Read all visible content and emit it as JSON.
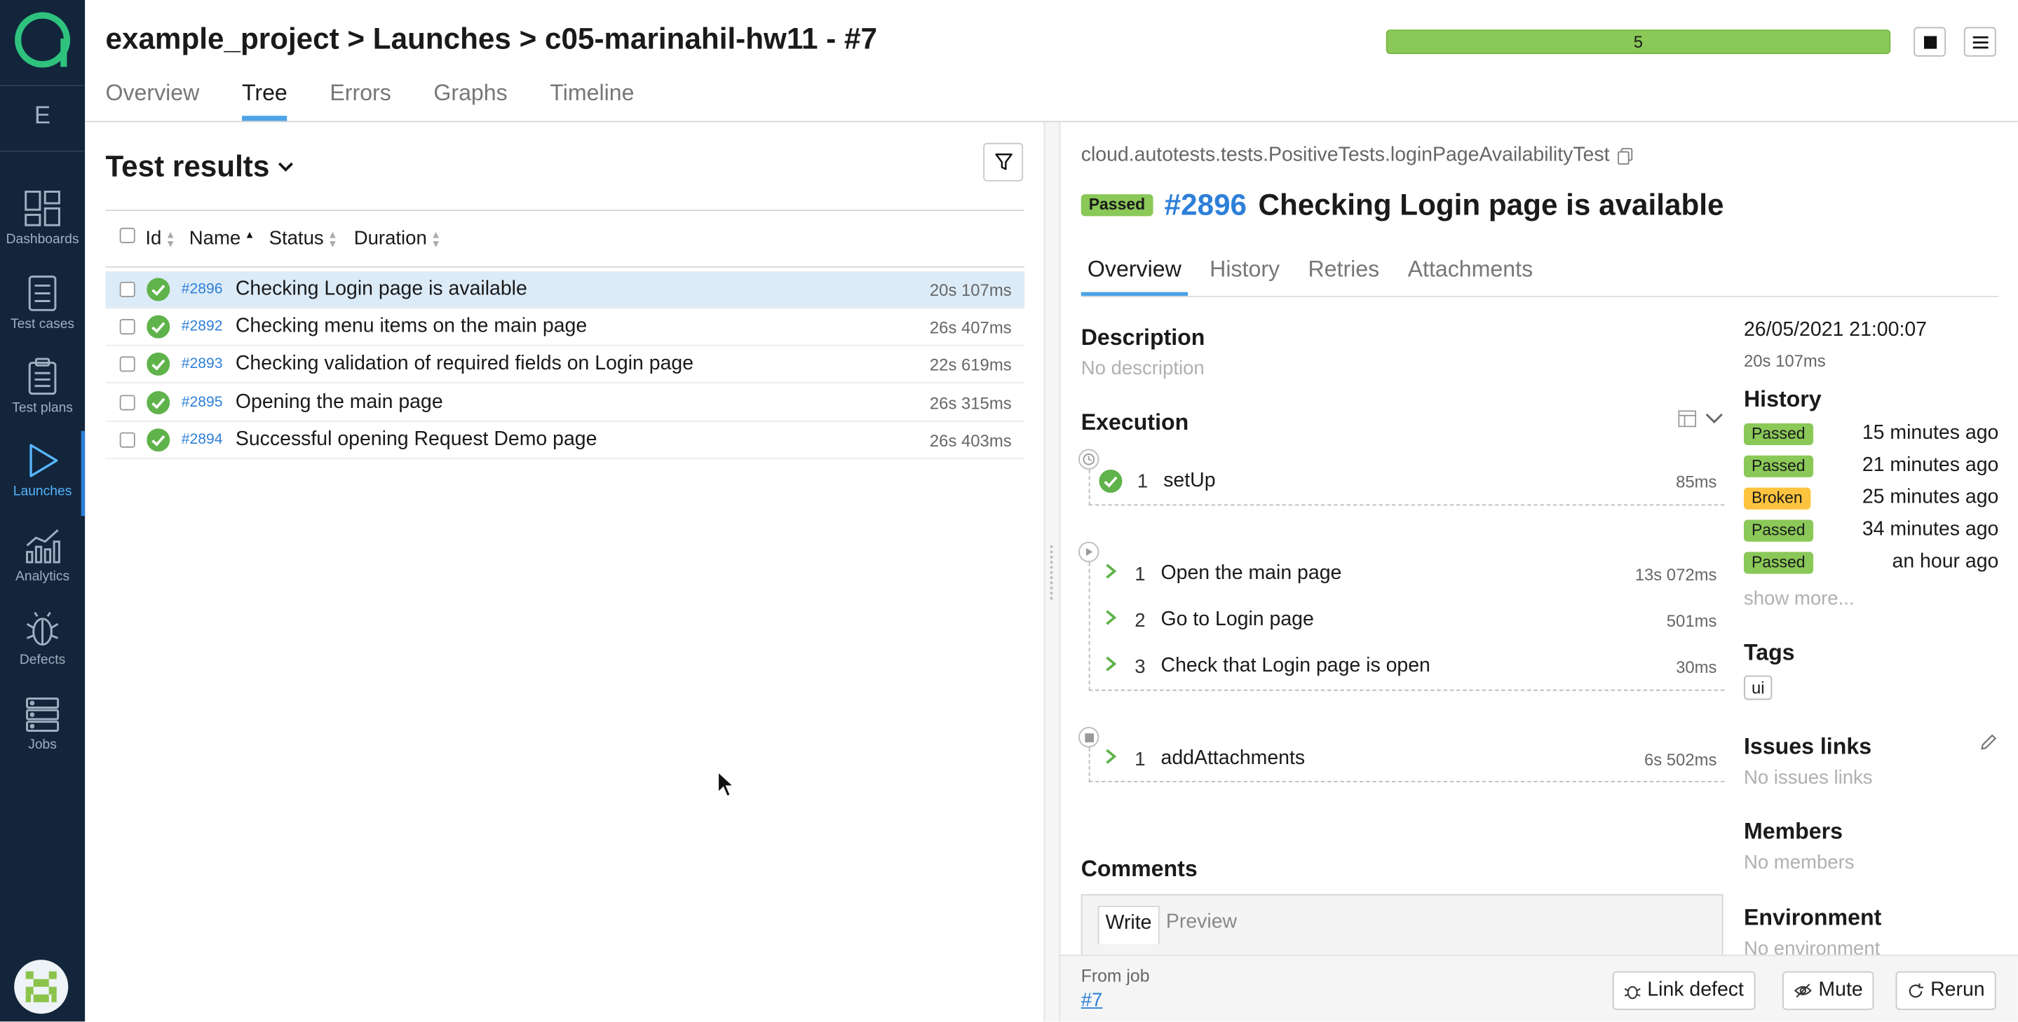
{
  "breadcrumb": {
    "project": "example_project",
    "sep1": ">",
    "section": "Launches",
    "sep2": ">",
    "launch": "c05-marinahil-hw11 - #7"
  },
  "progress": {
    "label": "5",
    "fraction": 1.0,
    "color": "#8ac858"
  },
  "top_tabs": [
    {
      "label": "Overview",
      "active": false
    },
    {
      "label": "Tree",
      "active": true
    },
    {
      "label": "Errors",
      "active": false
    },
    {
      "label": "Graphs",
      "active": false
    },
    {
      "label": "Timeline",
      "active": false
    }
  ],
  "sidebar": {
    "letter": "E",
    "items": [
      {
        "label": "Dashboards",
        "icon": "dashboards-icon"
      },
      {
        "label": "Test cases",
        "icon": "test-cases-icon"
      },
      {
        "label": "Test plans",
        "icon": "test-plans-icon"
      },
      {
        "label": "Launches",
        "icon": "launches-icon",
        "active": true
      },
      {
        "label": "Analytics",
        "icon": "analytics-icon"
      },
      {
        "label": "Defects",
        "icon": "defects-icon"
      },
      {
        "label": "Jobs",
        "icon": "jobs-icon"
      }
    ]
  },
  "results": {
    "title": "Test results",
    "columns": [
      "Id",
      "Name",
      "Status",
      "Duration"
    ],
    "rows": [
      {
        "id": "#2896",
        "name": "Checking Login page is available",
        "duration": "20s 107ms",
        "selected": true
      },
      {
        "id": "#2892",
        "name": "Checking menu items on the main page",
        "duration": "26s 407ms"
      },
      {
        "id": "#2893",
        "name": "Checking validation of required fields on Login page",
        "duration": "22s 619ms"
      },
      {
        "id": "#2895",
        "name": "Opening the main page",
        "duration": "26s 315ms"
      },
      {
        "id": "#2894",
        "name": "Successful opening Request Demo page",
        "duration": "26s 403ms"
      }
    ]
  },
  "detail": {
    "path": "cloud.autotests.tests.PositiveTests.loginPageAvailabilityTest",
    "status": "Passed",
    "id": "#2896",
    "name": "Checking Login page is available",
    "tabs": [
      "Overview",
      "History",
      "Retries",
      "Attachments"
    ],
    "description_title": "Description",
    "description": "No description",
    "execution_title": "Execution",
    "setup": [
      {
        "num": "1",
        "name": "setUp",
        "duration": "85ms"
      }
    ],
    "body": [
      {
        "num": "1",
        "name": "Open the main page",
        "duration": "13s 072ms"
      },
      {
        "num": "2",
        "name": "Go to Login page",
        "duration": "501ms"
      },
      {
        "num": "3",
        "name": "Check that Login page is open",
        "duration": "30ms"
      }
    ],
    "teardown": [
      {
        "num": "1",
        "name": "addAttachments",
        "duration": "6s 502ms"
      }
    ],
    "comments_title": "Comments",
    "comment_tabs": [
      "Write",
      "Preview"
    ],
    "date": "26/05/2021 21:00:07",
    "duration": "20s 107ms",
    "history_title": "History",
    "history": [
      {
        "status": "Passed",
        "time": "15 minutes ago"
      },
      {
        "status": "Passed",
        "time": "21 minutes ago"
      },
      {
        "status": "Broken",
        "time": "25 minutes ago"
      },
      {
        "status": "Passed",
        "time": "34 minutes ago"
      },
      {
        "status": "Passed",
        "time": "an hour ago"
      }
    ],
    "show_more": "show more...",
    "tags_title": "Tags",
    "tags": [
      "ui"
    ],
    "issues_title": "Issues links",
    "issues": "No issues links",
    "members_title": "Members",
    "members": "No members",
    "environment_title": "Environment",
    "environment": "No environment"
  },
  "footer": {
    "from_job": "From job",
    "job_link": "#7",
    "link_defect": "Link defect",
    "mute": "Mute",
    "rerun": "Rerun"
  },
  "colors": {
    "sidebar": "#12253a",
    "accent": "#2d7fd8",
    "passed": "#8ac858",
    "broken": "#ffc43f",
    "logo": "#2ec27e"
  }
}
